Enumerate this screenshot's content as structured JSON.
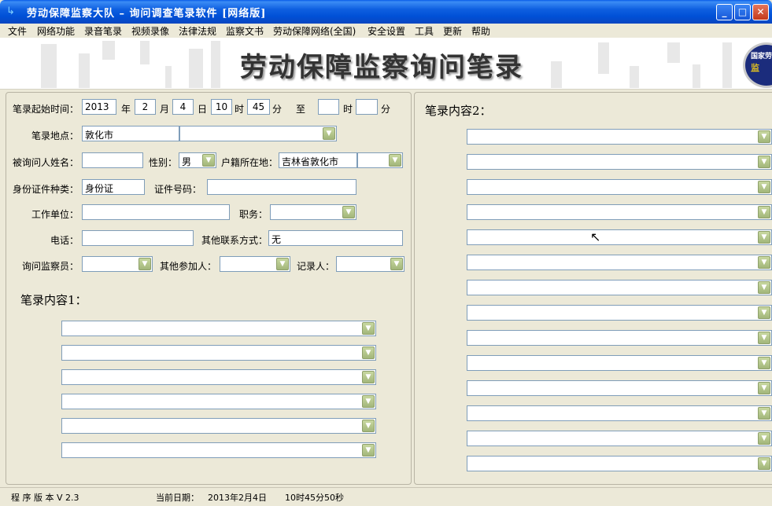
{
  "window": {
    "title": "劳动保障监察大队 – 询问调查笔录软件    [网络版]",
    "buttons": {
      "minimize": "_",
      "maximize": "□",
      "close": "✕"
    }
  },
  "menu": [
    "文件",
    "网络功能",
    "录音笔录",
    "视频录像",
    "法律法规",
    "监察文书",
    "劳动保障网络(全国)",
    "安全设置",
    "工具",
    "更新",
    "帮助"
  ],
  "banner": {
    "title": "劳动保障监察询问笔录",
    "badge_top": "国家劳",
    "badge_mid": "监"
  },
  "form": {
    "start_time_label": "笔录起始时间：",
    "year_value": "2013",
    "year_unit": "年",
    "month_value": "2",
    "month_unit": "月",
    "day_value": "4",
    "day_unit": "日",
    "hour_value": "10",
    "hour_unit": "时",
    "minute_value": "45",
    "minute_unit": "分",
    "to_label": "至",
    "end_hour_value": "",
    "end_hour_unit": "时",
    "end_minute_value": "",
    "end_minute_unit": "分",
    "location_label": "笔录地点：",
    "location_value": "敦化市",
    "location_combo_value": "",
    "name_label": "被询问人姓名：",
    "name_value": "",
    "gender_label": "性别：",
    "gender_value": "男",
    "hukou_label": "户籍所在地：",
    "hukou_value": "吉林省敦化市",
    "hukou_combo_value": "",
    "idtype_label": "身份证件种类：",
    "idtype_value": "身份证",
    "idnum_label": "证件号码：",
    "idnum_value": "",
    "workplace_label": "工作单位：",
    "workplace_value": "",
    "position_label": "职务：",
    "position_value": "",
    "phone_label": "电话：",
    "phone_value": "",
    "other_contact_label": "其他联系方式：",
    "other_contact_value": "无",
    "inspector_label": "询问监察员：",
    "inspector_value": "",
    "participant_label": "其他参加人：",
    "participant_value": "",
    "recorder_label": "记录人：",
    "recorder_value": ""
  },
  "content1": {
    "title": "笔录内容1：",
    "rows": [
      "",
      "",
      "",
      "",
      "",
      ""
    ]
  },
  "content2": {
    "title": "笔录内容2：",
    "rows": [
      "",
      "",
      "",
      "",
      "",
      "",
      "",
      "",
      "",
      "",
      "",
      "",
      "",
      ""
    ]
  },
  "status": {
    "version": "程 序 版 本 V 2.3",
    "date_label": "当前日期：",
    "date_value": "2013年2月4日",
    "time_value": "10时45分50秒"
  }
}
